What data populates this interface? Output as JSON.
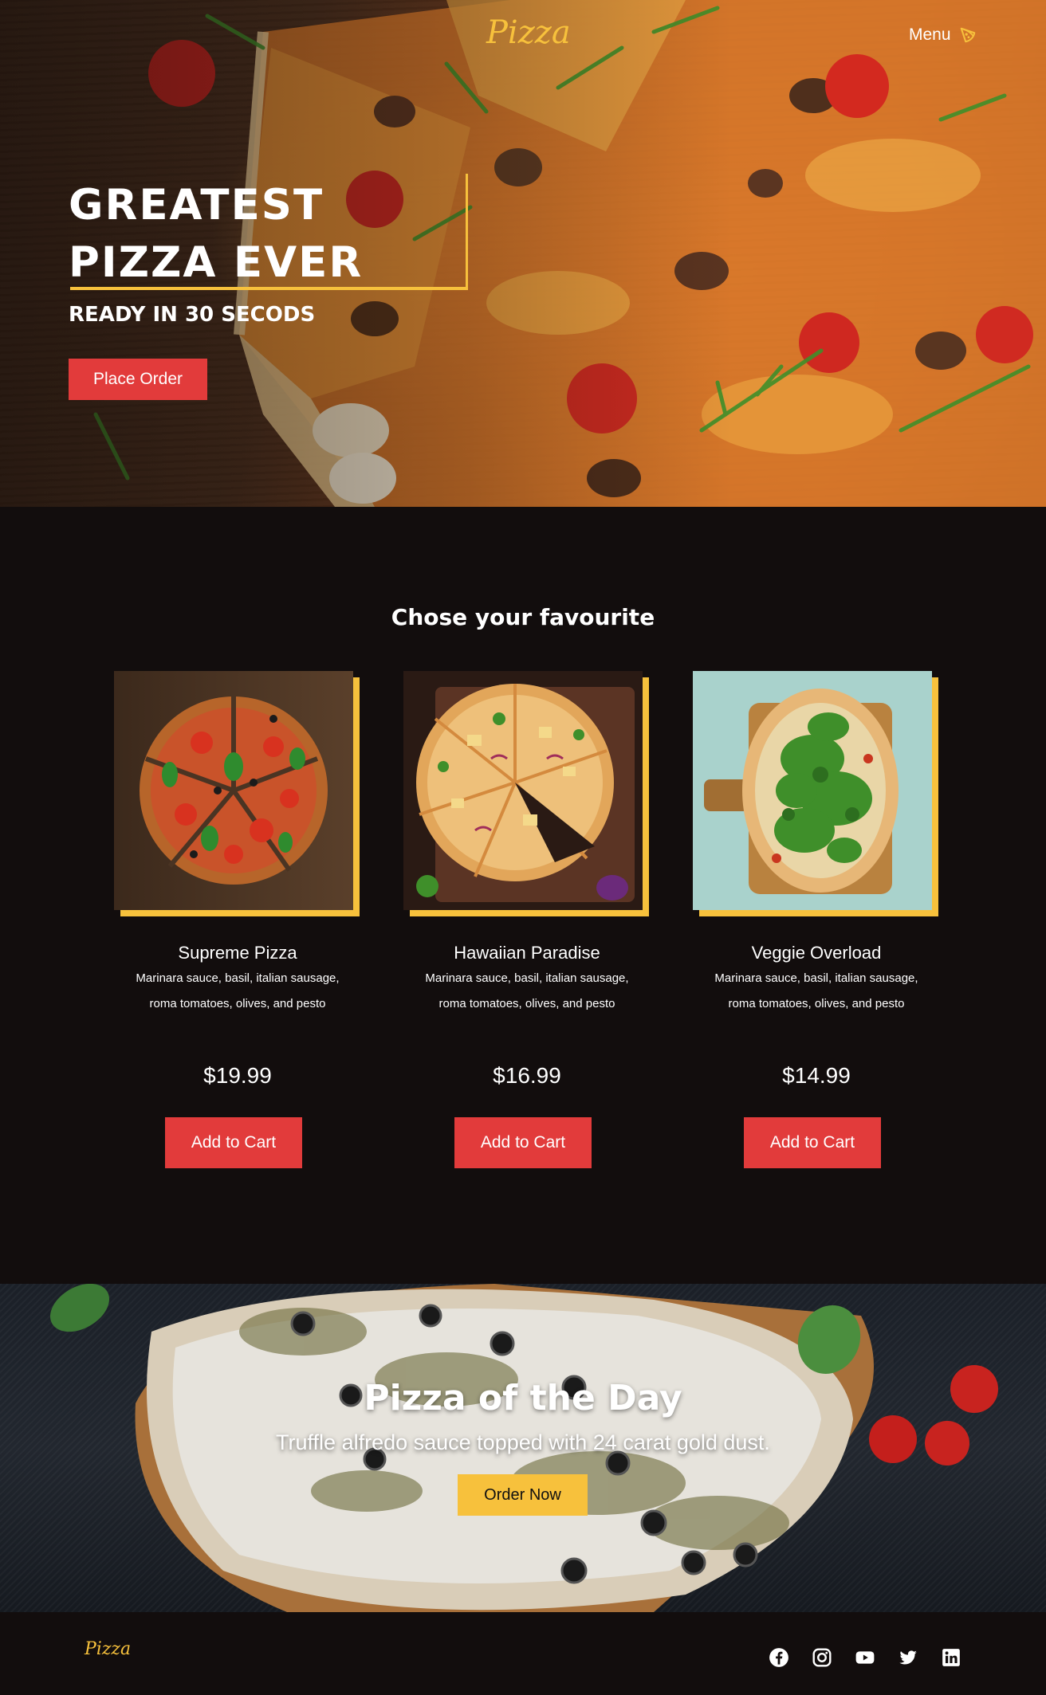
{
  "header": {
    "brand": "Pizza",
    "menu_label": "Menu",
    "menu_icon": "pizza-slice-icon"
  },
  "hero": {
    "title": "GREATEST PIZZA EVER",
    "subtitle": "READY IN 30 SECODS",
    "cta_label": "Place Order"
  },
  "menu": {
    "title": "Chose your favourite",
    "cart_label": "Add to Cart",
    "items": [
      {
        "name": "Supreme Pizza",
        "description": "Marinara sauce, basil, italian sausage, roma tomatoes, olives, and pesto",
        "price": "$19.99"
      },
      {
        "name": "Hawaiian Paradise",
        "description": "Marinara sauce, basil, italian sausage, roma tomatoes, olives, and pesto",
        "price": "$16.99"
      },
      {
        "name": "Veggie Overload",
        "description": "Marinara sauce, basil, italian sausage, roma tomatoes, olives, and pesto",
        "price": "$14.99"
      }
    ]
  },
  "pizza_of_the_day": {
    "title": "Pizza of the Day",
    "description": "Truffle alfredo sauce topped with 24 carat gold dust.",
    "cta_label": "Order Now"
  },
  "footer": {
    "brand": "Pizza",
    "social_icons": [
      "facebook-icon",
      "instagram-icon",
      "youtube-icon",
      "twitter-icon",
      "linkedin-icon"
    ]
  },
  "colors": {
    "accent_yellow": "#f7c13c",
    "button_red": "#e23b3b",
    "background_dark": "#120d0d"
  }
}
